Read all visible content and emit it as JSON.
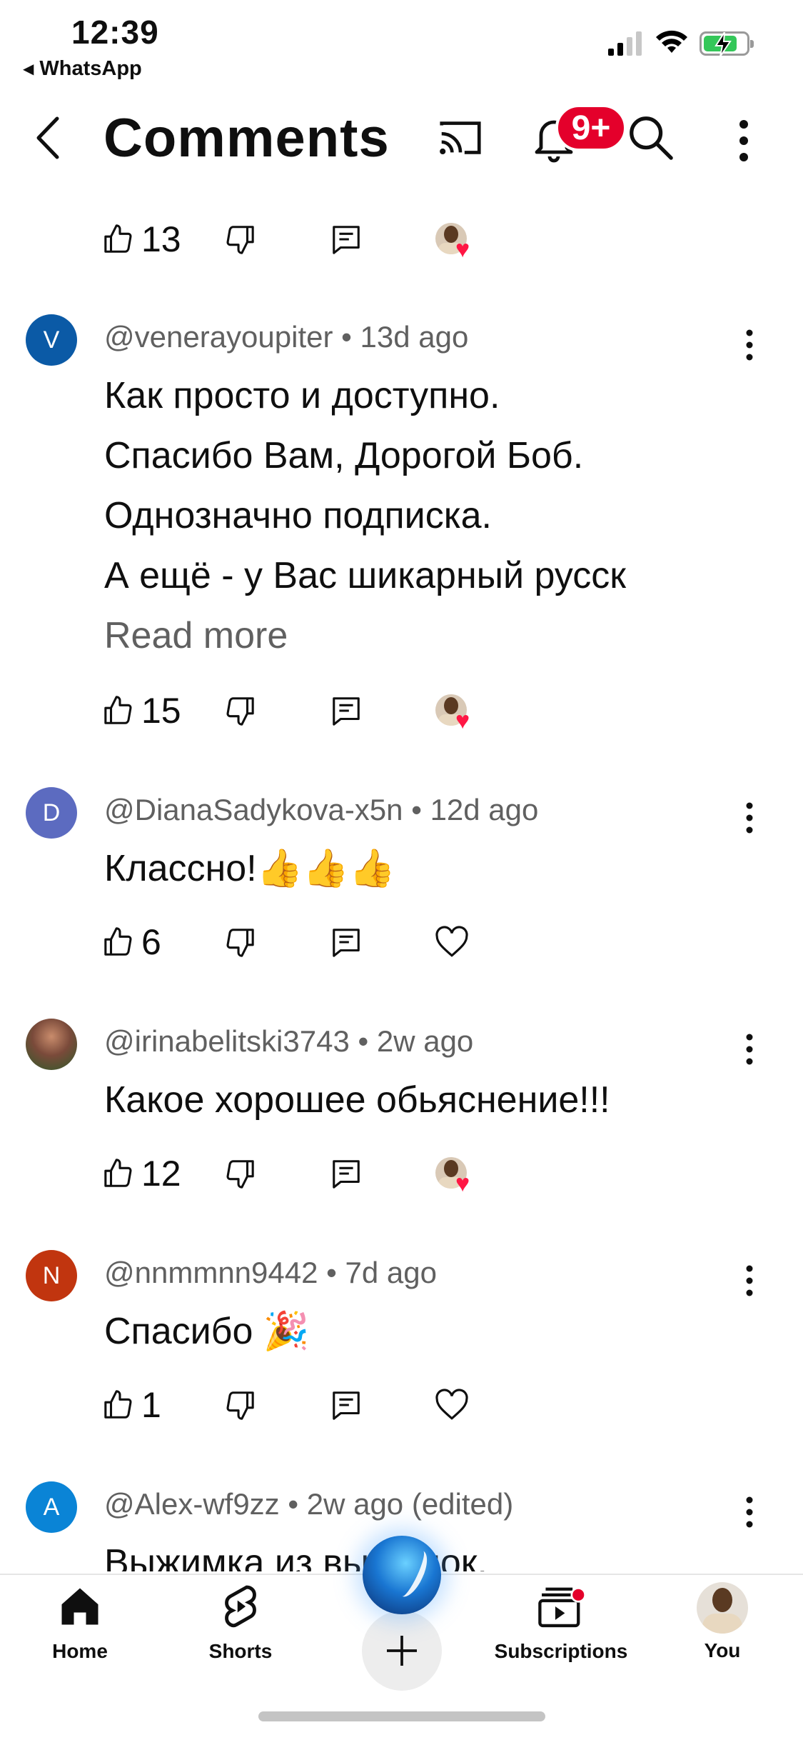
{
  "status_bar": {
    "time": "12:39",
    "back_app": "WhatsApp"
  },
  "header": {
    "title": "Comments",
    "notification_badge": "9+"
  },
  "top_partial_actions": {
    "like_count": "13"
  },
  "comments": [
    {
      "avatar_letter": "V",
      "avatar_color": "#0b5aa6",
      "meta": "@venerayoupiter • 13d ago",
      "lines": [
        "Как просто и доступно.",
        "Спасибо Вам, Дорогой Боб.",
        "Однозначно подписка.",
        "А ещё - у Вас шикарный русск"
      ],
      "read_more": "Read more",
      "like_count": "15",
      "creator_heart": true
    },
    {
      "avatar_letter": "D",
      "avatar_color": "#5c6bc0",
      "meta": "@DianaSadykova-x5n • 12d ago",
      "lines": [
        "Классно!👍👍👍"
      ],
      "like_count": "6",
      "creator_heart": false
    },
    {
      "avatar_letter": "",
      "avatar_color": "#7a4a3a",
      "meta": "@irinabelitski3743 • 2w ago",
      "lines": [
        "Какое хорошее обьяснение!!!"
      ],
      "like_count": "12",
      "creator_heart": true
    },
    {
      "avatar_letter": "N",
      "avatar_color": "#c1350f",
      "meta": "@nnmmnn9442 • 7d ago",
      "lines": [
        "Спасибо 🎉"
      ],
      "like_count": "1",
      "creator_heart": false
    },
    {
      "avatar_letter": "A",
      "avatar_color": "#0a84d6",
      "meta": "@Alex-wf9zz • 2w ago (edited)",
      "lines": [
        "Выжимка из выжимок."
      ]
    }
  ],
  "bottom_nav": {
    "home": "Home",
    "shorts": "Shorts",
    "subscriptions": "Subscriptions",
    "you": "You"
  },
  "colors": {
    "badge_red": "#e4002b",
    "heart_red": "#ff1744",
    "meta_gray": "#606060"
  }
}
